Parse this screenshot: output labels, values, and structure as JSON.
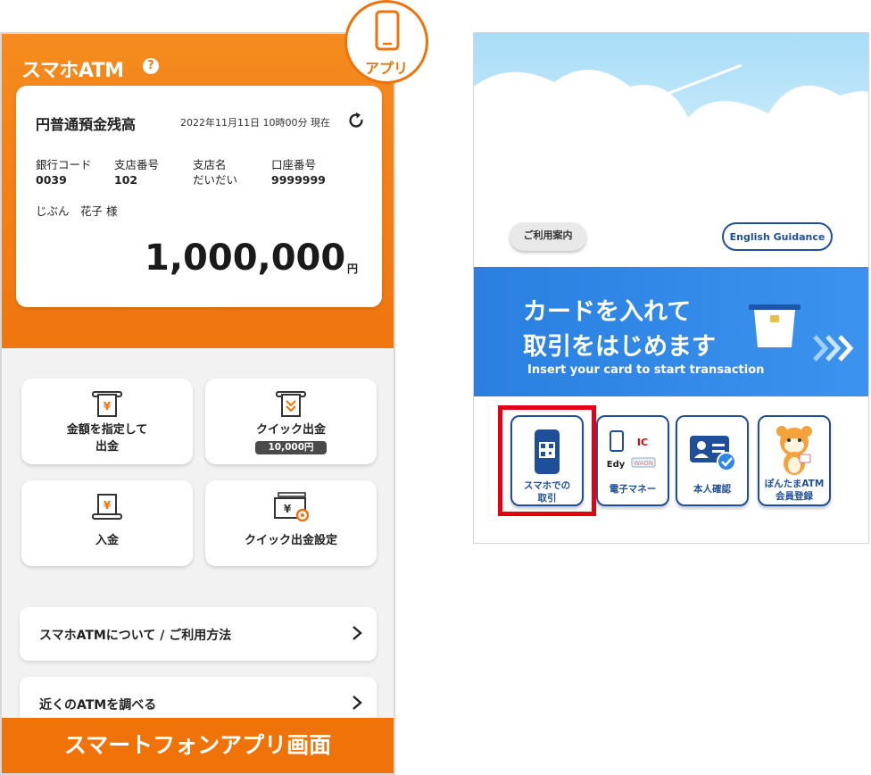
{
  "app": {
    "title": "スマホATM",
    "help_icon": "question-circle-icon",
    "badge_label": "アプリ",
    "badge_icon": "smartphone-icon",
    "balance": {
      "label": "円普通預金残高",
      "timestamp": "2022年11月11日 10時00分 現在",
      "refresh_icon": "refresh-icon",
      "bank_code_label": "銀行コード",
      "bank_code": "0039",
      "branch_no_label": "支店番号",
      "branch_no": "102",
      "branch_name_label": "支店名",
      "branch_name": "だいだい",
      "account_no_label": "口座番号",
      "account_no": "9999999",
      "holder": "じぶん　花子 様",
      "amount": "1,000,000",
      "currency": "円"
    },
    "tiles": [
      {
        "label": "金額を指定して\n出金",
        "icon": "cash-withdraw-icon"
      },
      {
        "label": "クイック出金",
        "badge": "10,000円",
        "icon": "quick-withdraw-icon"
      },
      {
        "label": "入金",
        "icon": "deposit-icon"
      },
      {
        "label": "クイック出金設定",
        "icon": "quick-settings-icon"
      }
    ],
    "menu": [
      {
        "label": "スマホATMについて / ご利用方法"
      },
      {
        "label": "近くのATMを調べる"
      }
    ],
    "caption": "スマートフォンアプリ画面"
  },
  "atm": {
    "guide_button": "ご利用案内",
    "english_button": "English Guidance",
    "banner_line1": "カードを入れて",
    "banner_line2": "取引をはじめます",
    "banner_en": "Insert your card to start transaction",
    "tiles": [
      {
        "label": "スマホでの\n取引",
        "icon": "smartphone-qr-icon"
      },
      {
        "label": "電子マネー",
        "icon": "e-money-icon"
      },
      {
        "label": "本人確認",
        "icon": "id-card-icon"
      },
      {
        "label": "ぽんたまATM\n会員登録",
        "icon": "raccoon-mascot-icon"
      }
    ],
    "emoney_logos": [
      "IC",
      "Edy",
      "WAON"
    ]
  },
  "colors": {
    "orange": "#f07309",
    "atm_blue": "#1f4f9b",
    "banner_blue": "#2f86e6",
    "highlight_red": "#e60012"
  }
}
